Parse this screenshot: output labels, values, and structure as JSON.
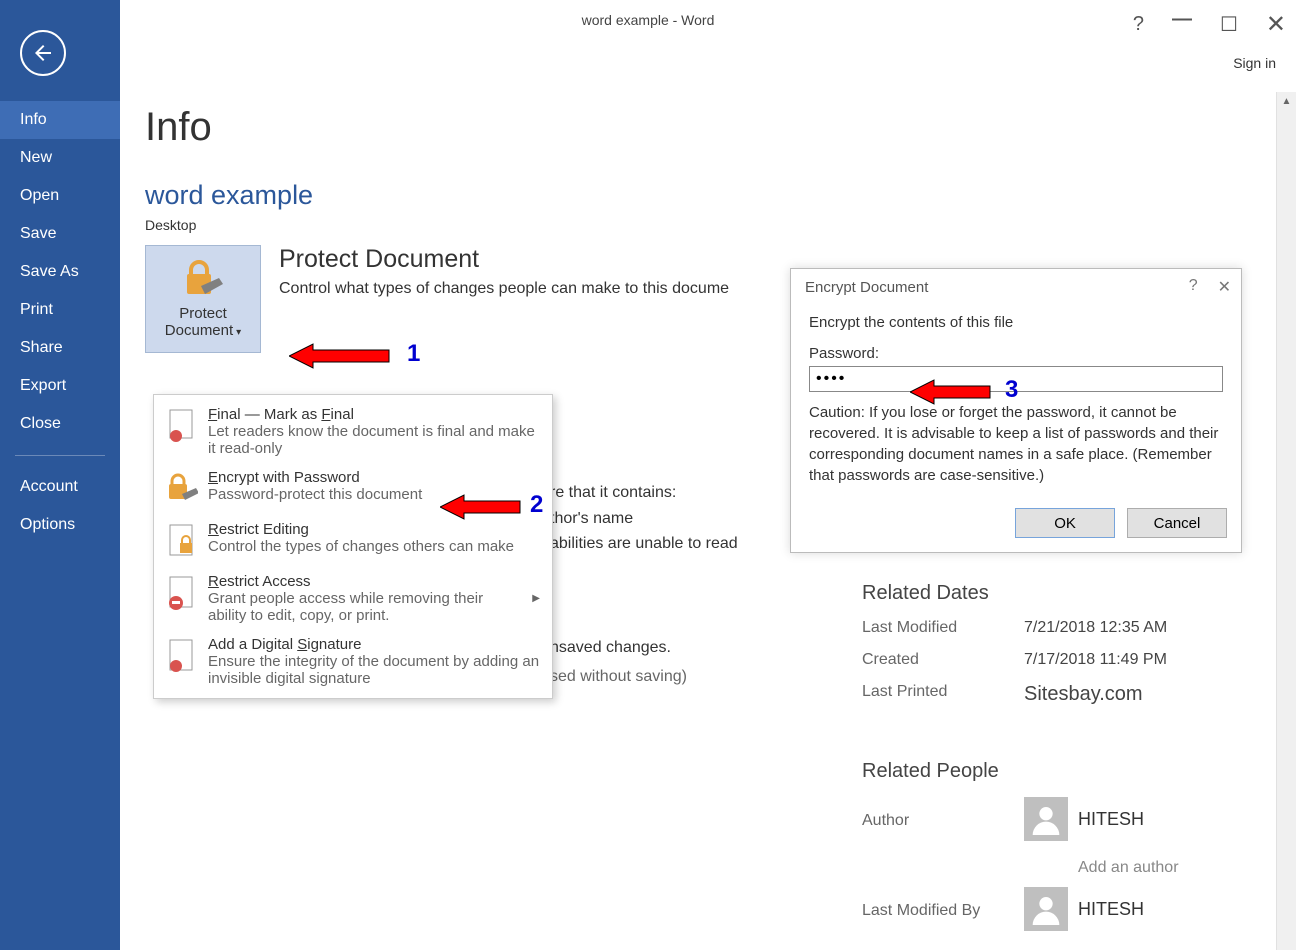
{
  "titlebar": {
    "title": "word example - Word",
    "signin": "Sign in"
  },
  "sidebar": {
    "items": [
      {
        "label": "Info",
        "active": true
      },
      {
        "label": "New"
      },
      {
        "label": "Open"
      },
      {
        "label": "Save"
      },
      {
        "label": "Save As"
      },
      {
        "label": "Print"
      },
      {
        "label": "Share"
      },
      {
        "label": "Export"
      },
      {
        "label": "Close"
      }
    ],
    "footer": [
      {
        "label": "Account"
      },
      {
        "label": "Options"
      }
    ]
  },
  "main": {
    "title": "Info",
    "docname": "word example",
    "location": "Desktop",
    "protect_btn_label": "Protect Document",
    "protect_section_title": "Protect Document",
    "protect_section_desc": "Control what types of changes people can make to this docume"
  },
  "dropdown": {
    "items": [
      {
        "title": "Mark as Final",
        "desc": "Let readers know the document is final and make it read-only"
      },
      {
        "title": "Encrypt with Password",
        "desc": "Password-protect this document"
      },
      {
        "title": "Restrict Editing",
        "desc": "Control the types of changes others can make"
      },
      {
        "title": "Restrict Access",
        "desc": "Grant people access while removing their ability to edit, copy, or print.",
        "arrow": true
      },
      {
        "title": "Add a Digital Signature",
        "desc": "Ensure the integrity of the document by adding an invisible digital signature"
      }
    ]
  },
  "leak": {
    "l1": "re that it contains:",
    "l2": "thor's name",
    "l3": "abilities are unable to read"
  },
  "manage": {
    "l1": "nsaved changes.",
    "l2": "sed without saving)"
  },
  "dialog": {
    "title": "Encrypt Document",
    "instruct": "Encrypt the contents of this file",
    "pw_label": "Password:",
    "pw_value": "••••",
    "caution": "Caution: If you lose or forget the password, it cannot be recovered. It is advisable to keep a list of passwords and their corresponding document names in a safe place. (Remember that passwords are case-sensitive.)",
    "ok": "OK",
    "cancel": "Cancel"
  },
  "related_dates": {
    "title": "Related Dates",
    "rows": [
      {
        "label": "Last Modified",
        "val": "7/21/2018 12:35 AM"
      },
      {
        "label": "Created",
        "val": "7/17/2018 11:49 PM"
      },
      {
        "label": "Last Printed",
        "val": "Sitesbay.com",
        "cls": "site-val"
      }
    ]
  },
  "related_people": {
    "title": "Related People",
    "author_label": "Author",
    "author_name": "HITESH",
    "add_author": "Add an author",
    "lastmod_label": "Last Modified By",
    "lastmod_name": "HITESH"
  },
  "annotations": {
    "n1": "1",
    "n2": "2",
    "n3": "3"
  }
}
